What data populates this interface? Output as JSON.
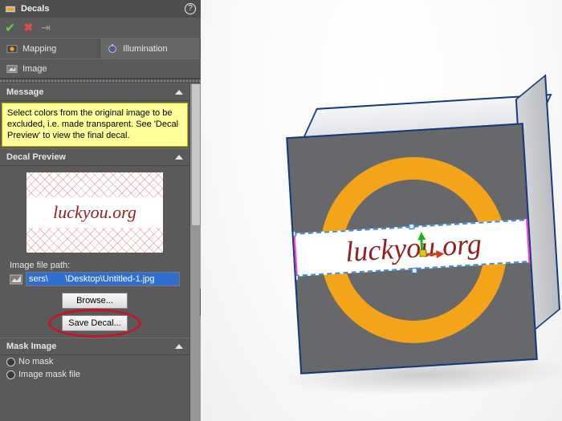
{
  "panel": {
    "title": "Decals",
    "tabs": {
      "mapping": "Mapping",
      "illumination": "Illumination"
    },
    "image_row": "Image",
    "message": {
      "title": "Message",
      "body": "Select colors from the original image to be excluded, i.e. made transparent. See 'Decal Preview' to view the final decal."
    },
    "preview": {
      "title": "Decal Preview",
      "decal_text": "luckyou.org",
      "path_label": "Image file path:",
      "path_value": "sers\\       \\Desktop\\Untitled-1.jpg",
      "browse_label": "Browse...",
      "save_label": "Save Decal..."
    },
    "mask": {
      "title": "Mask Image",
      "opts": {
        "none": "No mask",
        "file": "Image mask file"
      }
    }
  },
  "viewport": {
    "decal_text": "luckyou.org"
  }
}
